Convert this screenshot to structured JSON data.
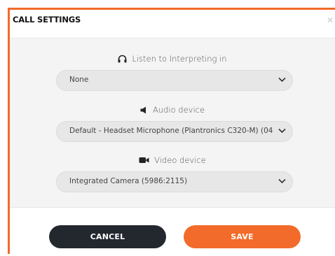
{
  "dialog": {
    "title": "CALL SETTINGS",
    "close_icon": "close-icon"
  },
  "fields": [
    {
      "label": "Listen to Interpreting in",
      "icon": "headphones-icon",
      "value": "None"
    },
    {
      "label": "Audio device",
      "icon": "speaker-icon",
      "value": "Default - Headset Microphone (Plantronics C320-M) (04"
    },
    {
      "label": "Video device",
      "icon": "video-camera-icon",
      "value": "Integrated Camera (5986:2115)"
    }
  ],
  "footer": {
    "cancel_label": "CANCEL",
    "save_label": "SAVE"
  },
  "colors": {
    "accent": "#f26b2a",
    "cancel_bg": "#23272e",
    "body_bg": "#f4f4f4",
    "select_bg": "#e7e7e7"
  }
}
